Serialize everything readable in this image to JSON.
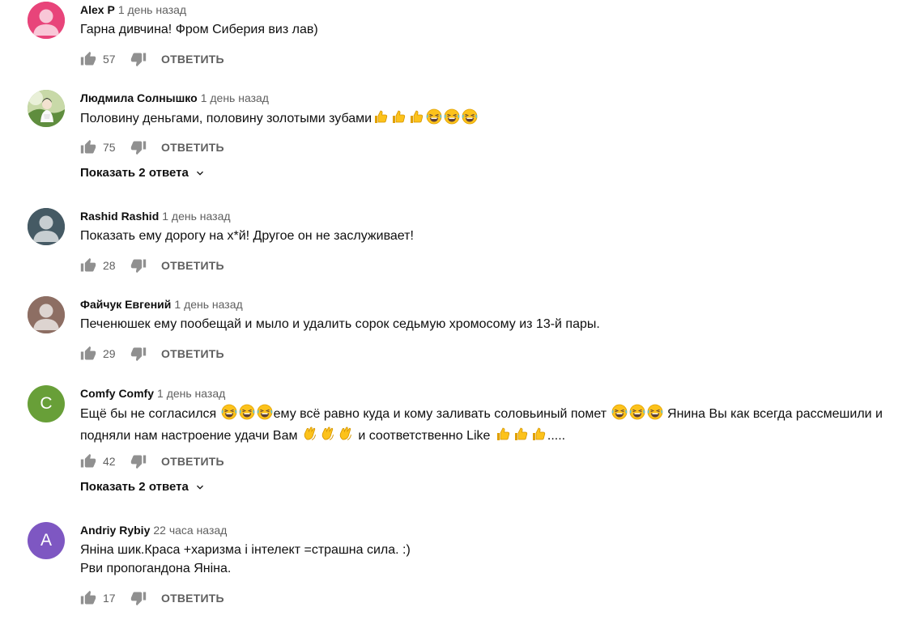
{
  "comments": [
    {
      "author": "Alex P",
      "time": "1 день назад",
      "avatar": {
        "type": "silhouette",
        "color": "#e8447a"
      },
      "lines": [
        [
          "Гарна дивчина! Фром Сиберия виз лав)"
        ]
      ],
      "likes": "57",
      "reply_label": "ОТВЕТИТЬ"
    },
    {
      "author": "Людмила Солнышко",
      "time": "1 день назад",
      "avatar": {
        "type": "photo",
        "color": "#7aa657"
      },
      "lines": [
        [
          "Половину деньгами, половину золотыми зубами",
          "thumbs-up-emoji",
          "thumbs-up-emoji",
          "thumbs-up-emoji",
          "laughing-emoji",
          "laughing-emoji",
          "laughing-emoji"
        ]
      ],
      "likes": "75",
      "reply_label": "ОТВЕТИТЬ",
      "replies_label": "Показать 2 ответа"
    },
    {
      "author": "Rashid Rashid",
      "time": "1 день назад",
      "avatar": {
        "type": "silhouette",
        "color": "#455a64"
      },
      "lines": [
        [
          "Показать ему дорогу на х*й! Другое он не заслуживает!"
        ]
      ],
      "likes": "28",
      "reply_label": "ОТВЕТИТЬ"
    },
    {
      "author": "Файчук Евгений",
      "time": "1 день назад",
      "avatar": {
        "type": "silhouette",
        "color": "#8d6e63"
      },
      "lines": [
        [
          "Печенюшек ему пообещай и мыло и удалить сорок седьмую хромосому из 13-й пары."
        ]
      ],
      "likes": "29",
      "reply_label": "ОТВЕТИТЬ"
    },
    {
      "author": "Comfy Comfy",
      "time": "1 день назад",
      "avatar": {
        "type": "letter",
        "letter": "C",
        "color": "#689f38"
      },
      "lines": [
        [
          "Ещё бы не согласился ",
          "laughing-emoji",
          "laughing-emoji",
          "laughing-emoji",
          "ему всё равно куда и кому заливать соловьиный помет ",
          "laughing-emoji",
          "laughing-emoji",
          "laughing-emoji",
          " Янина Вы как всегда рассмешили и"
        ],
        [
          "подняли нам настроение удачи Вам ",
          "clapping-emoji",
          "clapping-emoji",
          "clapping-emoji",
          " и соответственно Like ",
          "thumbs-up-emoji",
          "thumbs-up-emoji",
          "thumbs-up-emoji",
          "....."
        ]
      ],
      "likes": "42",
      "reply_label": "ОТВЕТИТЬ",
      "replies_label": "Показать 2 ответа"
    },
    {
      "author": "Andriy Rybiy",
      "time": "22 часа назад",
      "avatar": {
        "type": "letter",
        "letter": "A",
        "color": "#7e57c2"
      },
      "lines": [
        [
          "Яніна шик.Краса +харизма і інтелект =страшна сила. :)"
        ],
        [
          "Рви пропогандона Яніна."
        ]
      ],
      "likes": "17",
      "reply_label": "ОТВЕТИТЬ"
    }
  ]
}
